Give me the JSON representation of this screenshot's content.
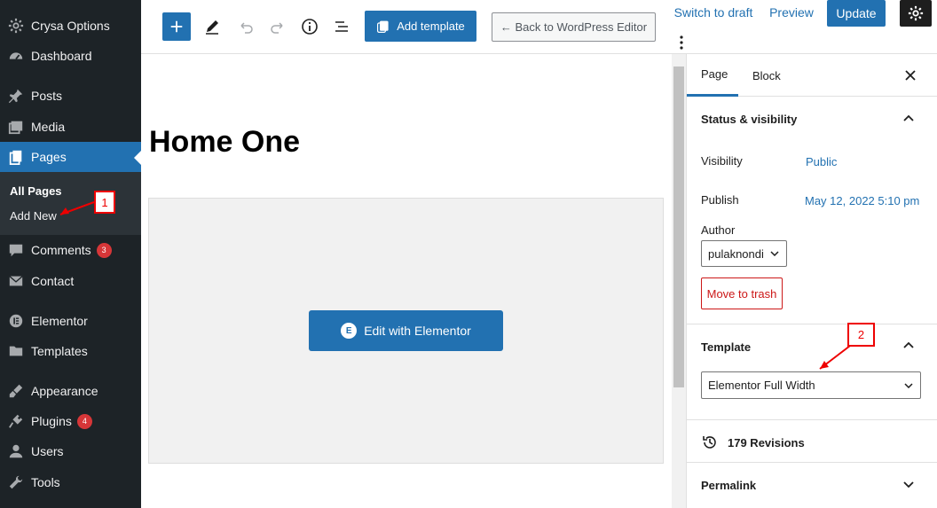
{
  "sidebar": {
    "items": [
      {
        "label": "Crysa Options",
        "icon": "gear-icon"
      },
      {
        "label": "Dashboard",
        "icon": "dashboard-icon"
      },
      {
        "label": "Posts",
        "icon": "pin-icon"
      },
      {
        "label": "Media",
        "icon": "media-icon"
      },
      {
        "label": "Pages",
        "icon": "pages-icon"
      },
      {
        "label": "Comments",
        "icon": "comment-icon",
        "badge": "3"
      },
      {
        "label": "Contact",
        "icon": "mail-icon"
      },
      {
        "label": "Elementor",
        "icon": "elementor-icon"
      },
      {
        "label": "Templates",
        "icon": "folder-icon"
      },
      {
        "label": "Appearance",
        "icon": "brush-icon"
      },
      {
        "label": "Plugins",
        "icon": "plug-icon",
        "badge": "4"
      },
      {
        "label": "Users",
        "icon": "user-icon"
      },
      {
        "label": "Tools",
        "icon": "wrench-icon"
      }
    ],
    "submenu": [
      "All Pages",
      "Add New"
    ],
    "active": "Pages"
  },
  "toolbar": {
    "add_template": "Add template",
    "back_editor": "← Back to WordPress Editor",
    "switch_draft": "Switch to draft",
    "preview": "Preview",
    "update": "Update"
  },
  "canvas": {
    "title": "Home One",
    "edit_button": "Edit with Elementor"
  },
  "panel": {
    "tabs": [
      "Page",
      "Block"
    ],
    "status_title": "Status & visibility",
    "visibility_label": "Visibility",
    "visibility_value": "Public",
    "publish_label": "Publish",
    "publish_value": "May 12, 2022 5:10 pm",
    "author_label": "Author",
    "author_value": "pulaknondi",
    "trash": "Move to trash",
    "template_title": "Template",
    "template_value": "Elementor Full Width",
    "revisions": "179 Revisions",
    "permalink": "Permalink"
  },
  "annotations": [
    "1",
    "2"
  ],
  "colors": {
    "accent": "#2271b1",
    "sidebar": "#1d2327",
    "annotation": "#e00000"
  }
}
